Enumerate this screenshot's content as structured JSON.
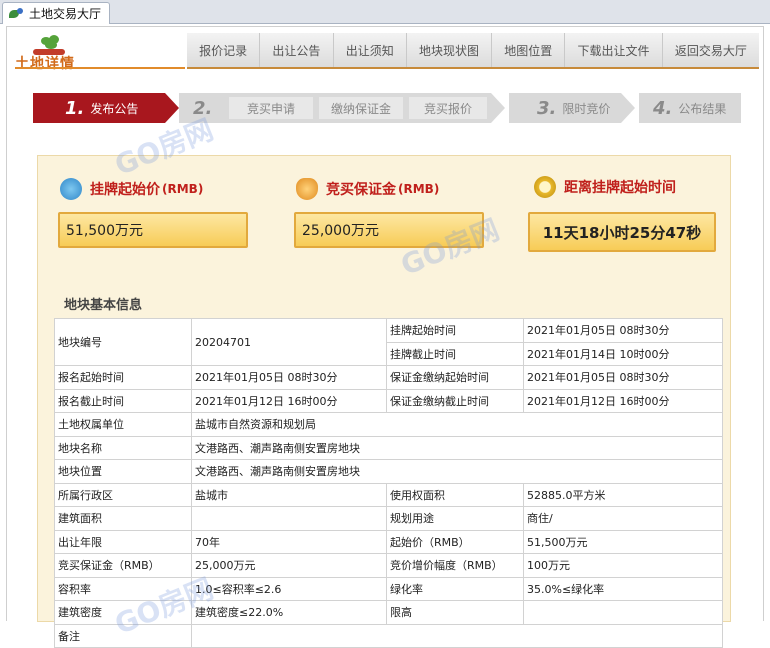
{
  "browser": {
    "tab_title": "土地交易大厅"
  },
  "logo": {
    "text": "土地详情"
  },
  "nav": [
    "报价记录",
    "出让公告",
    "出让须知",
    "地块现状图",
    "地图位置",
    "下载出让文件",
    "返回交易大厅"
  ],
  "steps": {
    "s1": {
      "num": "1.",
      "label": "发布公告"
    },
    "s2": {
      "num": "2."
    },
    "sub": [
      "竞买申请",
      "缴纳保证金",
      "竞买报价"
    ],
    "s3": {
      "num": "3.",
      "label": "限时竞价"
    },
    "s4": {
      "num": "4.",
      "label": "公布结果"
    }
  },
  "kpi": {
    "start_price": {
      "label": "挂牌起始价",
      "unit": "(RMB)",
      "value": "51,500万元"
    },
    "deposit": {
      "label": "竞买保证金",
      "unit": "(RMB)",
      "value": "25,000万元"
    },
    "countdown": {
      "label": "距离挂牌起始时间",
      "value": "11天18小时25分47秒"
    }
  },
  "section_title": "地块基本信息",
  "table": {
    "r1": {
      "k1": "地块编号",
      "v1": "20204701",
      "k2a": "挂牌起始时间",
      "v2a": "2021年01月05日 08时30分",
      "k2b": "挂牌截止时间",
      "v2b": "2021年01月14日 10时00分"
    },
    "r2": {
      "k1": "报名起始时间",
      "v1": "2021年01月05日 08时30分",
      "k2": "保证金缴纳起始时间",
      "v2": "2021年01月05日 08时30分"
    },
    "r3": {
      "k1": "报名截止时间",
      "v1": "2021年01月12日 16时00分",
      "k2": "保证金缴纳截止时间",
      "v2": "2021年01月12日 16时00分"
    },
    "r4": {
      "k1": "土地权属单位",
      "v1": "盐城市自然资源和规划局"
    },
    "r5": {
      "k1": "地块名称",
      "v1": "文港路西、潮声路南侧安置房地块"
    },
    "r6": {
      "k1": "地块位置",
      "v1": "文港路西、潮声路南侧安置房地块"
    },
    "r7": {
      "k1": "所属行政区",
      "v1": "盐城市",
      "k2": "使用权面积",
      "v2": "52885.0平方米"
    },
    "r8": {
      "k1": "建筑面积",
      "v1": "",
      "k2": "规划用途",
      "v2": "商住/"
    },
    "r9": {
      "k1": "出让年限",
      "v1": "70年",
      "k2": "起始价（RMB）",
      "v2": "51,500万元"
    },
    "r10": {
      "k1": "竞买保证金（RMB）",
      "v1": "25,000万元",
      "k2": "竞价增价幅度（RMB）",
      "v2": "100万元"
    },
    "r11": {
      "k1": "容积率",
      "v1": "1.0≤容积率≤2.6",
      "k2": "绿化率",
      "v2": "35.0%≤绿化率"
    },
    "r12": {
      "k1": "建筑密度",
      "v1": "建筑密度≤22.0%",
      "k2": "限高",
      "v2": ""
    },
    "r13": {
      "k1": "备注",
      "v1": ""
    }
  },
  "watermark": "GO房网",
  "colors": {
    "accent_red": "#a8171e",
    "kpi_text": "#c0201c",
    "panel_bg": "#fbf3dc",
    "kpi_gold": "#f7cc57"
  }
}
